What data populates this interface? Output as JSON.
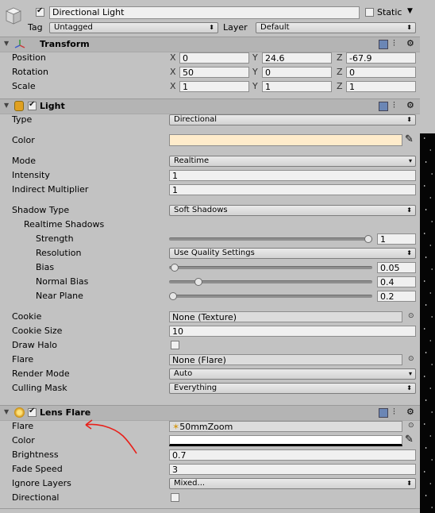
{
  "object": {
    "name": "Directional Light",
    "static_label": "Static",
    "tag_label": "Tag",
    "tag_value": "Untagged",
    "layer_label": "Layer",
    "layer_value": "Default"
  },
  "transform": {
    "title": "Transform",
    "position": {
      "label": "Position",
      "x": "0",
      "y": "24.6",
      "z": "-67.9"
    },
    "rotation": {
      "label": "Rotation",
      "x": "50",
      "y": "0",
      "z": "0"
    },
    "scale": {
      "label": "Scale",
      "x": "1",
      "y": "1",
      "z": "1"
    },
    "axis_x": "X",
    "axis_y": "Y",
    "axis_z": "Z"
  },
  "light": {
    "title": "Light",
    "type_label": "Type",
    "type_value": "Directional",
    "color_label": "Color",
    "color_value": "#ffeccb",
    "mode_label": "Mode",
    "mode_value": "Realtime",
    "intensity_label": "Intensity",
    "intensity_value": "1",
    "indirect_label": "Indirect Multiplier",
    "indirect_value": "1",
    "shadow_type_label": "Shadow Type",
    "shadow_type_value": "Soft Shadows",
    "realtime_shadows_label": "Realtime Shadows",
    "strength_label": "Strength",
    "strength_value": "1",
    "strength_fraction": 1.0,
    "resolution_label": "Resolution",
    "resolution_value": "Use Quality Settings",
    "bias_label": "Bias",
    "bias_value": "0.05",
    "bias_fraction": 0.01,
    "normal_bias_label": "Normal Bias",
    "normal_bias_value": "0.4",
    "normal_bias_fraction": 0.13,
    "near_plane_label": "Near Plane",
    "near_plane_value": "0.2",
    "near_plane_fraction": 0.0,
    "cookie_label": "Cookie",
    "cookie_value": "None (Texture)",
    "cookie_size_label": "Cookie Size",
    "cookie_size_value": "10",
    "draw_halo_label": "Draw Halo",
    "flare_label": "Flare",
    "flare_value": "None (Flare)",
    "render_mode_label": "Render Mode",
    "render_mode_value": "Auto",
    "culling_mask_label": "Culling Mask",
    "culling_mask_value": "Everything"
  },
  "lens_flare": {
    "title": "Lens Flare",
    "flare_label": "Flare",
    "flare_value": "50mmZoom",
    "color_label": "Color",
    "color_value": "#ffffff",
    "brightness_label": "Brightness",
    "brightness_value": "0.7",
    "fade_speed_label": "Fade Speed",
    "fade_speed_value": "3",
    "ignore_layers_label": "Ignore Layers",
    "ignore_layers_value": "Mixed...",
    "directional_label": "Directional"
  }
}
